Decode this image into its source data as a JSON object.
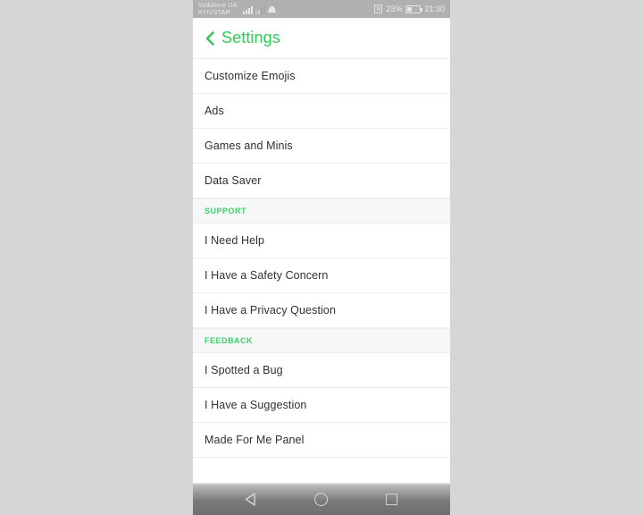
{
  "status_bar": {
    "carrier_line1": "Vodafone UA",
    "carrier_line2": "KYIVSTAR",
    "nfc_label": "N",
    "battery_percent": "23%",
    "time": "21:30",
    "icons": [
      "signal-icon",
      "signal-icon",
      "bell-icon",
      "nfc-icon",
      "battery-icon"
    ]
  },
  "header": {
    "back_icon": "chevron-left-icon",
    "title": "Settings"
  },
  "sections": [
    {
      "header": null,
      "items": [
        {
          "label": "Customize Emojis"
        },
        {
          "label": "Ads"
        },
        {
          "label": "Games and Minis"
        },
        {
          "label": "Data Saver"
        }
      ]
    },
    {
      "header": "SUPPORT",
      "items": [
        {
          "label": "I Need Help"
        },
        {
          "label": "I Have a Safety Concern"
        },
        {
          "label": "I Have a Privacy Question"
        }
      ]
    },
    {
      "header": "FEEDBACK",
      "items": [
        {
          "label": "I Spotted a Bug"
        },
        {
          "label": "I Have a Suggestion"
        },
        {
          "label": "Made For Me Panel"
        }
      ]
    }
  ],
  "nav_bar": {
    "back": "triangle-back-icon",
    "home": "circle-home-icon",
    "recents": "square-recents-icon"
  },
  "colors": {
    "accent_green": "#35c75a",
    "section_green": "#3fd069",
    "row_text": "#2f3033",
    "section_bg": "#f6f7f8",
    "divider": "#ededed",
    "page_bg": "#d6d6d6",
    "status_bar_bg": "#b0b0b0"
  }
}
